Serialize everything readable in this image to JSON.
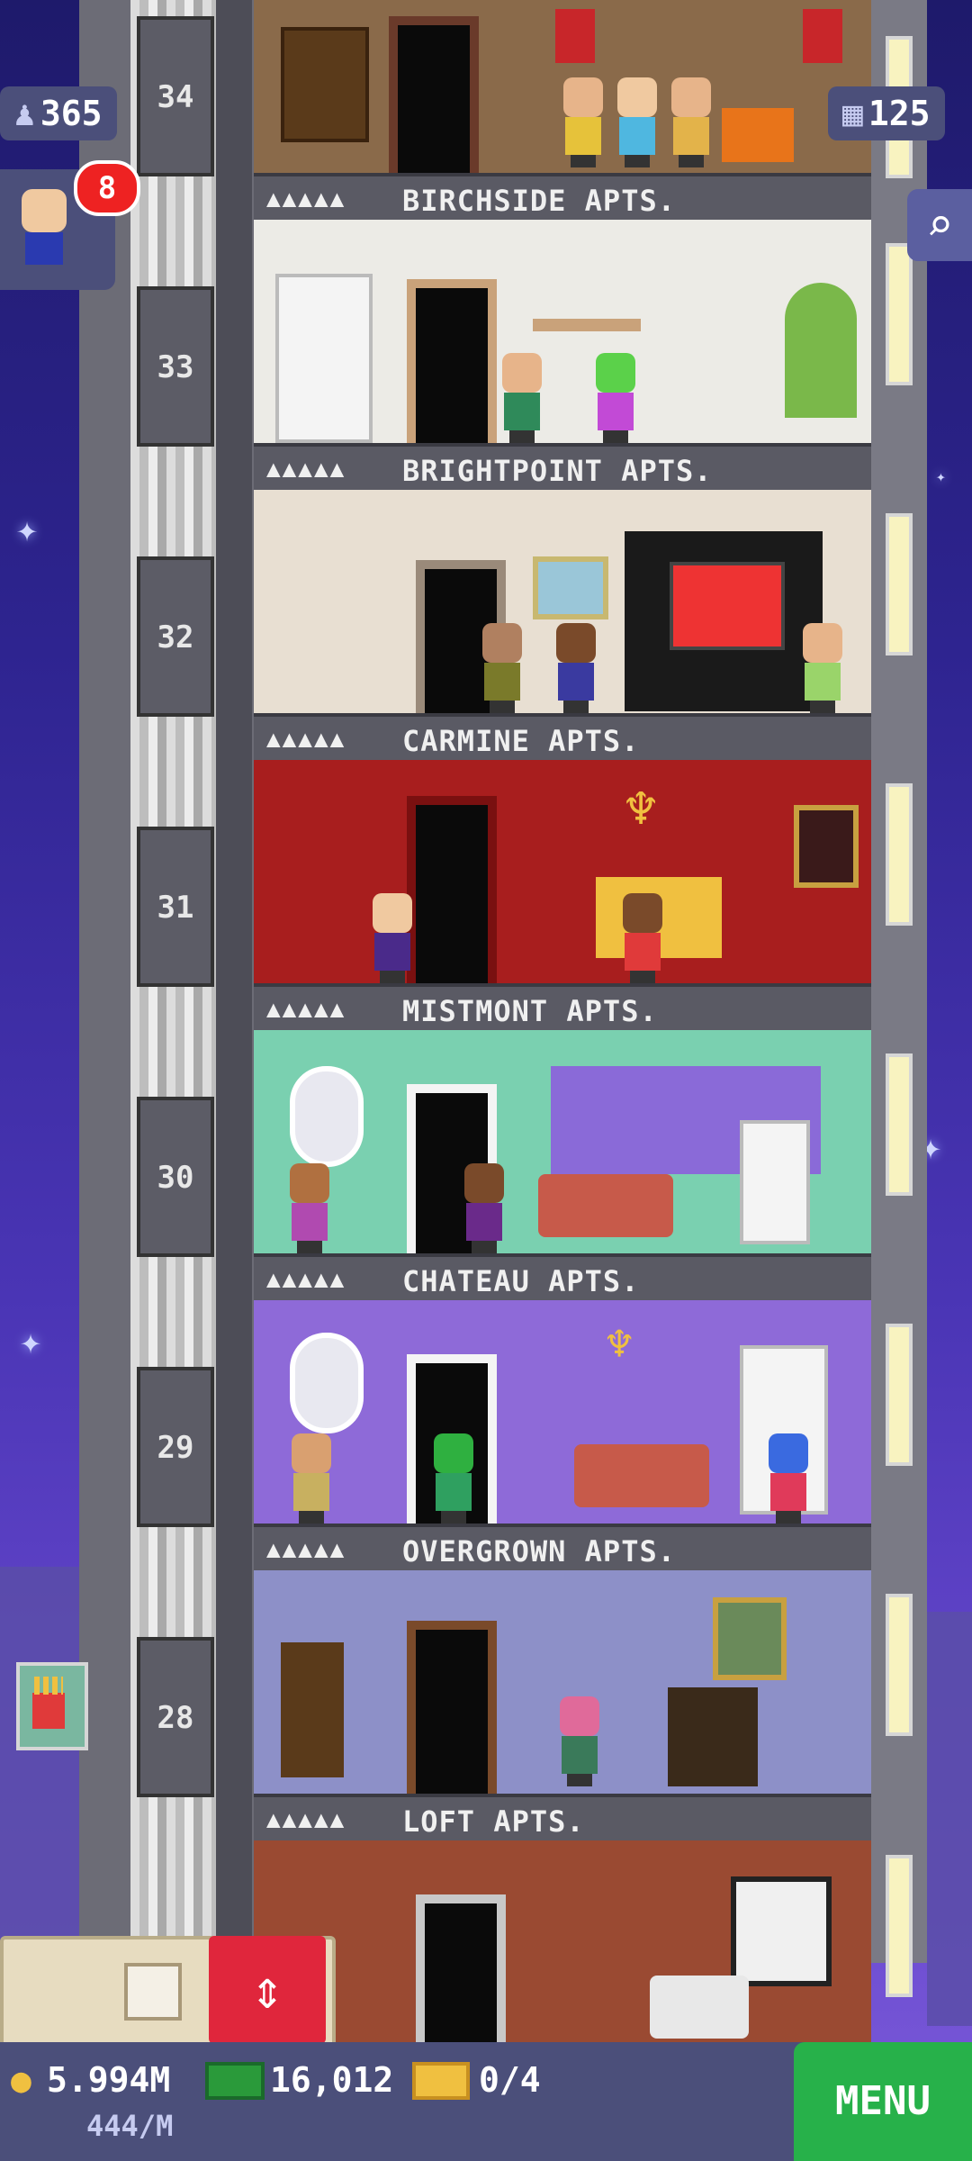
{
  "hud": {
    "population": "365",
    "floors_count": "125",
    "notification_count": "8"
  },
  "floors": [
    {
      "number": "34",
      "stars": "▲▲▲▲▲",
      "name": "BIRCHSIDE APTS."
    },
    {
      "number": "33",
      "stars": "▲▲▲▲▲",
      "name": "BRIGHTPOINT APTS."
    },
    {
      "number": "32",
      "stars": "▲▲▲▲▲",
      "name": "CARMINE APTS."
    },
    {
      "number": "31",
      "stars": "▲▲▲▲▲",
      "name": "MISTMONT APTS."
    },
    {
      "number": "30",
      "stars": "▲▲▲▲▲",
      "name": "CHATEAU APTS."
    },
    {
      "number": "29",
      "stars": "▲▲▲▲▲",
      "name": "OVERGROWN APTS."
    },
    {
      "number": "28",
      "stars": "▲▲▲▲▲",
      "name": "LOFT APTS."
    }
  ],
  "bottom_bar": {
    "coins": "5.994M",
    "coin_rate": "444/M",
    "bux": "16,012",
    "vip_tickets": "0/4",
    "menu_label": "MENU"
  },
  "icons": {
    "population": "person-icon",
    "floors": "building-icon",
    "zoom": "magnifier-icon",
    "coins": "coin-icon",
    "bux": "bux-icon",
    "tickets": "ticket-icon",
    "build": "build-icon",
    "elevator": "elevator-icon",
    "fries": "fries-icon"
  },
  "colors": {
    "sky_top": "#1e1a6b",
    "sky_bottom": "#7a5ad8",
    "menu_green": "#27b14a",
    "elevator_red": "#e0263c",
    "badge_red": "#e22222"
  }
}
